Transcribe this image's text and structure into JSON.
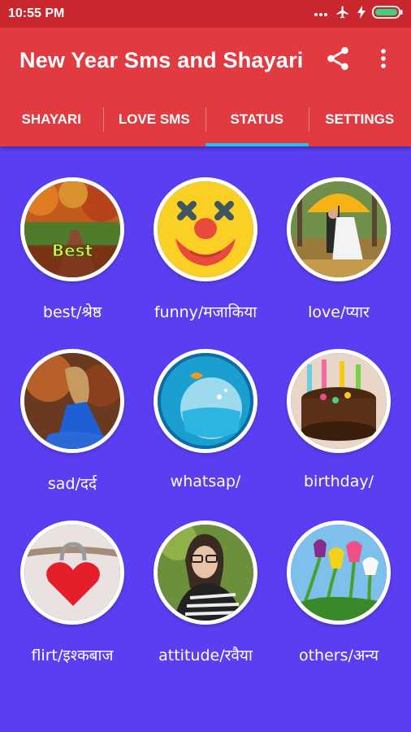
{
  "status_bar": {
    "time": "10:55 PM",
    "icons": [
      "more-dots-icon",
      "airplane-mode-icon",
      "battery-charging-icon"
    ]
  },
  "app_bar": {
    "title": "New Year Sms and Shayari",
    "actions": [
      "share-icon",
      "overflow-menu-icon"
    ]
  },
  "tabs": [
    {
      "label": "SHAYARI",
      "active": false
    },
    {
      "label": "LOVE SMS",
      "active": false
    },
    {
      "label": "STATUS",
      "active": true
    },
    {
      "label": "SETTINGS",
      "active": false
    }
  ],
  "categories": [
    {
      "label": "best/श्रेष्ठ",
      "image_text": "Best"
    },
    {
      "label": "funny/मजाकिया"
    },
    {
      "label": "love/प्यार"
    },
    {
      "label": "sad/दर्द"
    },
    {
      "label": "whatsap/"
    },
    {
      "label": "birthday/"
    },
    {
      "label": "flirt/इश्कबाज"
    },
    {
      "label": "attitude/रवैया"
    },
    {
      "label": "others/अन्य"
    }
  ],
  "colors": {
    "status_bar": "#c9262d",
    "app_bar": "#e13a40",
    "tab_indicator": "#27c0e8",
    "background": "#5a3ff2"
  }
}
